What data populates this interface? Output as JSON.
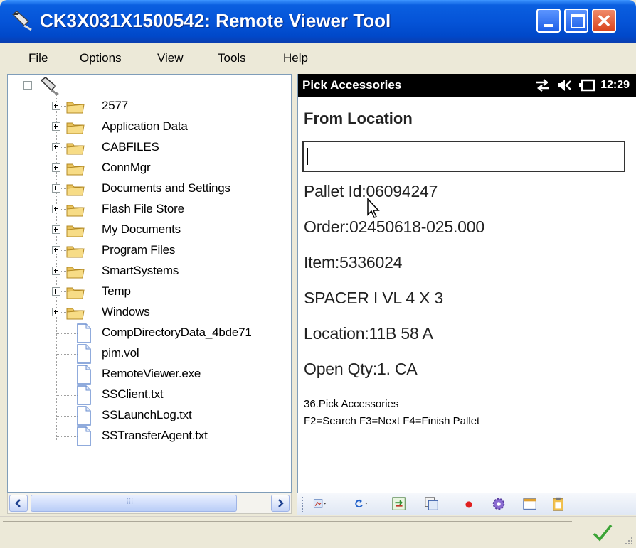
{
  "window": {
    "title": "CK3X031X1500542: Remote Viewer Tool"
  },
  "menu": [
    "File",
    "Options",
    "View",
    "Tools",
    "Help"
  ],
  "tree": {
    "folders": [
      "2577",
      "Application Data",
      "CABFILES",
      "ConnMgr",
      "Documents and Settings",
      "Flash File Store",
      "My Documents",
      "Program Files",
      "SmartSystems",
      "Temp",
      "Windows"
    ],
    "files": [
      "CompDirectoryData_4bde71",
      "pim.vol",
      "RemoteViewer.exe",
      "SSClient.txt",
      "SSLaunchLog.txt",
      "SSTransferAgent.txt"
    ]
  },
  "device": {
    "title": "Pick Accessories",
    "clock": "12:29",
    "from_location_label": "From Location",
    "from_location_value": "",
    "pallet": "Pallet Id:06094247",
    "order": "Order:02450618-025.000",
    "item": "Item:5336024",
    "description": "SPACER I VL 4 X 3",
    "location": "Location:11B  58 A",
    "open_qty": "Open Qty:1. CA",
    "screen_name": "36.Pick Accessories",
    "function_keys": "F2=Search F3=Next F4=Finish Pallet"
  },
  "toolbar_icons": [
    "screenshot-dropdown-icon",
    "refresh-dropdown-icon",
    "sync-icon",
    "copy-screen-icon",
    "record-icon",
    "settings-gear-icon",
    "window-icon",
    "clipboard-icon"
  ],
  "colors": {
    "titlebar": "#0554d8",
    "close_button": "#d9431c",
    "status_check": "#3aa335"
  }
}
